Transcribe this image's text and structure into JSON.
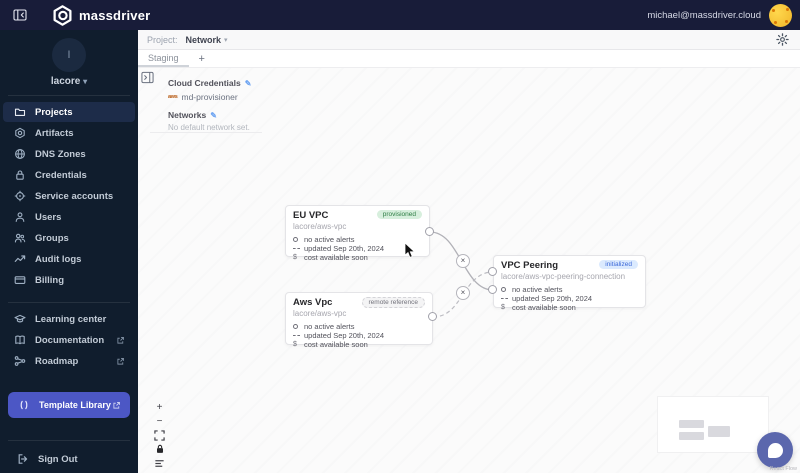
{
  "topbar": {
    "brand": "massdriver",
    "user_email": "michael@massdriver.cloud"
  },
  "org": {
    "name": "lacore",
    "initial": "l",
    "caret": "▾"
  },
  "sidebar": {
    "items": [
      {
        "label": "Projects",
        "active": true
      },
      {
        "label": "Artifacts"
      },
      {
        "label": "DNS Zones"
      },
      {
        "label": "Credentials"
      },
      {
        "label": "Service accounts"
      },
      {
        "label": "Users"
      },
      {
        "label": "Groups"
      },
      {
        "label": "Audit logs"
      },
      {
        "label": "Billing"
      }
    ],
    "secondary": [
      {
        "label": "Learning center",
        "external": false
      },
      {
        "label": "Documentation",
        "external": true
      },
      {
        "label": "Roadmap",
        "external": true
      }
    ],
    "template_library": "Template Library",
    "sign_out": "Sign Out"
  },
  "header": {
    "project_label": "Project:",
    "project_name": "Network",
    "caret": "▾"
  },
  "tabs": {
    "staging": "Staging",
    "add": "+"
  },
  "config": {
    "cloud_credentials_label": "Cloud Credentials",
    "provisioner_icon": "aws",
    "provisioner_name": "md-provisioner",
    "networks_label": "Networks",
    "networks_empty": "No default network set.",
    "edit_glyph": "✎"
  },
  "nodes": [
    {
      "title": "EU VPC",
      "subtitle": "lacore/aws-vpc",
      "badge": "provisioned",
      "rows": [
        "no active alerts",
        "updated Sep 20th, 2024",
        "cost available soon"
      ]
    },
    {
      "title": "Aws Vpc",
      "subtitle": "lacore/aws-vpc",
      "badge": "remote reference",
      "rows": [
        "no active alerts",
        "updated Sep 20th, 2024",
        "cost available soon"
      ]
    },
    {
      "title": "VPC Peering",
      "subtitle": "lacore/aws-vpc-peering-connection",
      "badge": "initialized",
      "rows": [
        "no active alerts",
        "updated Sep 20th, 2024",
        "cost available soon"
      ]
    }
  ],
  "edges": {
    "disconnect_glyph": "×"
  },
  "controls": {
    "zoom_in": "+",
    "zoom_out": "−"
  },
  "canvas": {
    "attribution": "React Flow"
  },
  "colors": {
    "topbar_bg": "#181c39",
    "sidebar_bg": "#101d2d",
    "accent_button": "#4c57c5",
    "badge_provisioned_bg": "#d7efdd",
    "badge_provisioned_text": "#2e7d44",
    "badge_remote_bg": "#f4f4f5",
    "badge_remote_text": "#71717a",
    "badge_initialized_bg": "#dbeafe",
    "badge_initialized_text": "#3b68d8",
    "avatar_bg": "#f0b429"
  }
}
